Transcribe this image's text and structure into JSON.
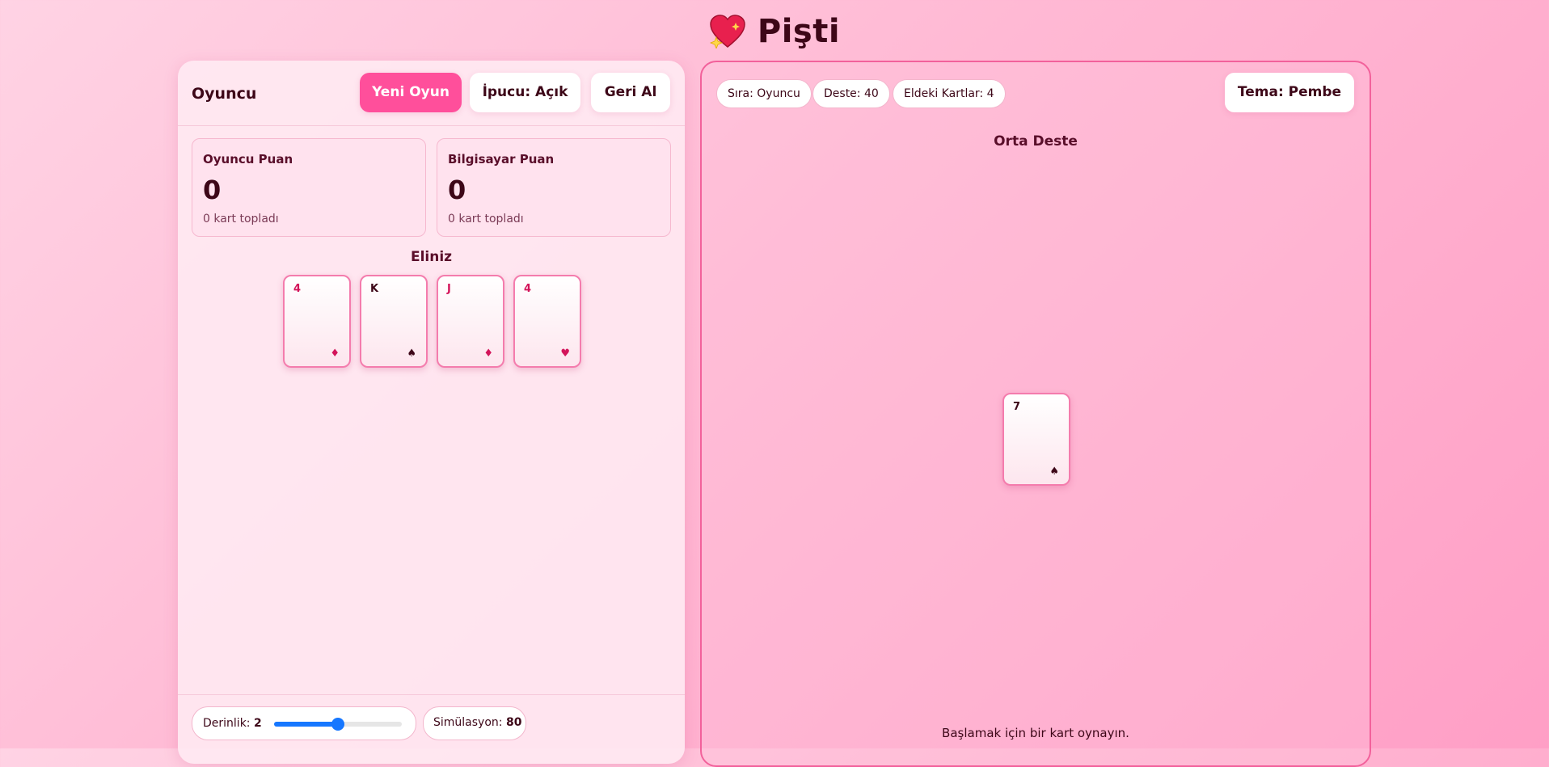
{
  "app": {
    "title": "Pişti",
    "logo_icon": "sparkling-heart-icon"
  },
  "left_panel": {
    "title": "Oyuncu",
    "buttons": {
      "new_game": "Yeni Oyun",
      "hint": "İpucu: Açık",
      "undo": "Geri Al"
    },
    "scores": [
      {
        "label": "Oyuncu Puan",
        "value": "0",
        "collected": "0 kart topladı"
      },
      {
        "label": "Bilgisayar Puan",
        "value": "0",
        "collected": "0 kart topladı"
      }
    ],
    "hand_title": "Eliniz",
    "hand": [
      {
        "rank": "4",
        "suit": "♦",
        "suit_name": "diamonds",
        "color": "#d3145a"
      },
      {
        "rank": "K",
        "suit": "♠",
        "suit_name": "spades",
        "color": "#3d0718"
      },
      {
        "rank": "J",
        "suit": "♦",
        "suit_name": "diamonds",
        "color": "#d3145a"
      },
      {
        "rank": "4",
        "suit": "♥",
        "suit_name": "hearts",
        "color": "#d3145a"
      }
    ],
    "footer": {
      "depth_label": "Derinlik:",
      "depth_value": "2",
      "depth_slider_fraction": 0.5,
      "simulation_label": "Simülasyon:",
      "simulation_value": "80"
    }
  },
  "right_panel": {
    "chips": {
      "turn": "Sıra: Oyuncu",
      "deck": "Deste: 40",
      "hand_cards": "Eldeki Kartlar: 4"
    },
    "theme_button": "Tema: Pembe",
    "middle_title": "Orta Deste",
    "table_card": {
      "rank": "7",
      "suit": "♠",
      "suit_name": "spades",
      "color": "#3d0718"
    },
    "status": "Başlamak için bir kart oynayın."
  },
  "colors": {
    "accent": "#ff4f9b",
    "border": "#f2619b",
    "red_suit": "#d3145a",
    "dark": "#3d0718",
    "slider": "#1677ff"
  }
}
